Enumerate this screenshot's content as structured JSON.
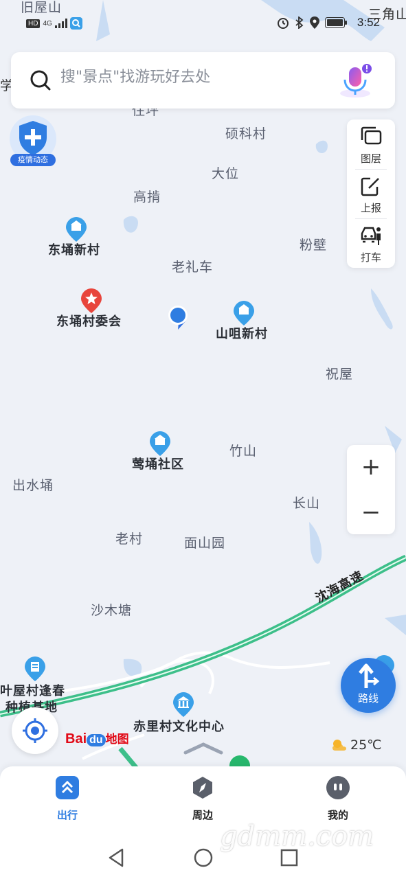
{
  "status_bar": {
    "time": "3:52",
    "network_badge": "HD",
    "network_type": "4G"
  },
  "search": {
    "placeholder": "搜\"景点\"找游玩好去处"
  },
  "epidemic": {
    "label": "疫情动态"
  },
  "tools": [
    {
      "label": "图层",
      "icon": "layers-icon"
    },
    {
      "label": "上报",
      "icon": "report-icon"
    },
    {
      "label": "打车",
      "icon": "taxi-icon"
    }
  ],
  "map_labels": {
    "place_1": "旧屋山",
    "place_2": "三角山",
    "place_3": "学",
    "place_4": "硕科村",
    "place_5": "大位",
    "place_6": "高掯",
    "place_7": "粉壁",
    "place_8": "老礼车",
    "place_9": "祝屋",
    "place_10": "竹山",
    "place_11": "出水埇",
    "place_12": "长山",
    "place_13": "老村",
    "place_14": "面山园",
    "place_15": "沙木塘",
    "place_16": "住坪",
    "road": "沈海高速"
  },
  "pois": {
    "poi_1": "东埇新村",
    "poi_2": "东埇村委会",
    "poi_3": "山咀新村",
    "poi_4": "莺埇社区",
    "poi_5_line1": "叶屋村逢春",
    "poi_5_line2": "种植基地",
    "poi_6": "赤里村文化中心"
  },
  "zoom": {
    "in": "+",
    "out": "−"
  },
  "route": {
    "label": "路线"
  },
  "logo": {
    "brand_bai": "Bai",
    "brand_du": "du",
    "brand_map": "地图"
  },
  "weather": {
    "temp": "25℃"
  },
  "bottom_nav": [
    {
      "label": "出行",
      "active": true
    },
    {
      "label": "周边",
      "active": false
    },
    {
      "label": "我的",
      "active": false
    }
  ],
  "watermark": "gdmm.com",
  "colors": {
    "accent": "#2f7de1",
    "highway": "#3dbf8a",
    "poi_blue": "#3aa0e8",
    "poi_red": "#e8453c",
    "map_bg": "#eef1f7",
    "water": "#c9dcf3"
  }
}
